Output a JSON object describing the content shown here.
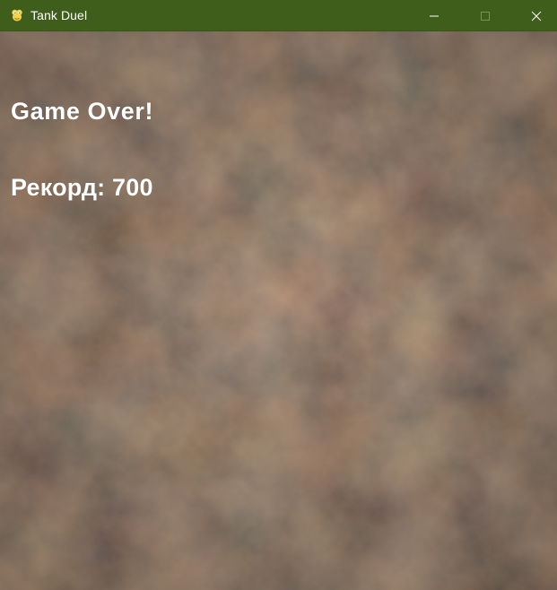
{
  "window": {
    "title": "Tank Duel",
    "titlebar_color": "#3f5e1b",
    "icons": [
      "python-snake-icon",
      "minimize-icon",
      "maximize-icon",
      "close-icon"
    ]
  },
  "game": {
    "background": "rusty-metal-texture",
    "game_over_text": "Game Over!",
    "record_label": "Рекорд",
    "record_value": 700,
    "record_text": "Рекорд: 700",
    "text_color": "#ffffff"
  }
}
